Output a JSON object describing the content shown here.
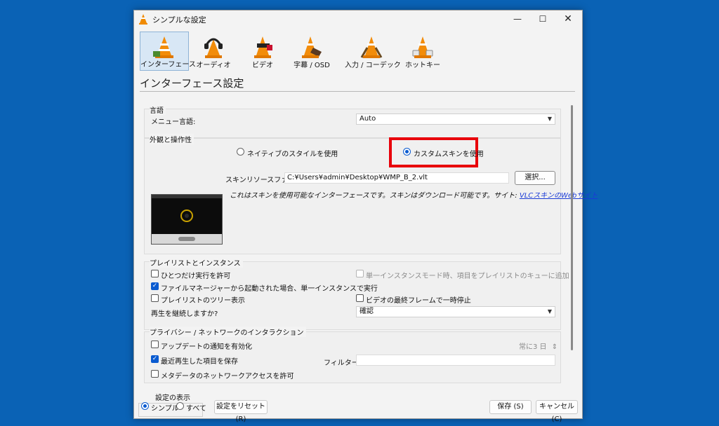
{
  "window": {
    "title": "シンプルな設定",
    "controls": {
      "minimize": "—",
      "maximize": "☐",
      "close": "✕"
    }
  },
  "toolbar": {
    "items": [
      {
        "label": "インターフェース",
        "icon": "interface-cone-icon",
        "active": true
      },
      {
        "label": "オーディオ",
        "icon": "audio-cone-icon",
        "active": false
      },
      {
        "label": "ビデオ",
        "icon": "video-cone-icon",
        "active": false
      },
      {
        "label": "字幕 / OSD",
        "icon": "subtitle-cone-icon",
        "active": false
      },
      {
        "label": "入力 / コーデック",
        "icon": "input-cone-icon",
        "active": false
      },
      {
        "label": "ホットキー",
        "icon": "hotkey-cone-icon",
        "active": false
      }
    ]
  },
  "page": {
    "title": "インターフェース設定"
  },
  "language": {
    "group_label": "言語",
    "menu_language_label": "メニュー言語:",
    "menu_language_value": "Auto"
  },
  "appearance": {
    "group_label": "外観と操作性",
    "native_style_label": "ネイティブのスタイルを使用",
    "custom_skin_label": "カスタムスキンを使用",
    "selected": "custom_skin",
    "skin_file_label": "スキンリソースファイル:",
    "skin_file_value": "C:¥Users¥admin¥Desktop¥WMP_B_2.vlt",
    "choose_button": "選択...",
    "description": "これはスキンを使用可能なインターフェースです。スキンはダウンロード可能です。サイト:",
    "link_text": "VLCスキンのWebサイト"
  },
  "playlist": {
    "group_label": "プレイリストとインスタンス",
    "allow_single": {
      "label": "ひとつだけ実行を許可",
      "checked": false
    },
    "enqueue_single": {
      "label": "単一インスタンスモード時、項目をプレイリストのキューに追加",
      "checked": false,
      "disabled": true
    },
    "file_manager_single": {
      "label": "ファイルマネージャーから起動された場合、単一インスタンスで実行",
      "checked": true
    },
    "tree_view": {
      "label": "プレイリストのツリー表示",
      "checked": false
    },
    "pause_last_frame": {
      "label": "ビデオの最終フレームで一時停止",
      "checked": false
    },
    "resume_label": "再生を継続しますか?",
    "resume_value": "確認"
  },
  "privacy": {
    "group_label": "プライバシー / ネットワークのインタラクション",
    "update_notify": {
      "label": "アップデートの通知を有効化",
      "checked": false
    },
    "update_interval": "常に3 日",
    "save_recent": {
      "label": "最近再生した項目を保存",
      "checked": true
    },
    "filter_label": "フィルター:",
    "filter_value": "",
    "metadata_access": {
      "label": "メタデータのネットワークアクセスを許可",
      "checked": false
    }
  },
  "footer": {
    "show_settings_label": "設定の表示",
    "simple_label": "シンプル",
    "all_label": "すべて",
    "selected": "simple",
    "reset_button": "設定をリセット (R)",
    "save_button": "保存 (S)",
    "cancel_button": "キャンセル (C)"
  },
  "colors": {
    "desktop": "#0a62b5",
    "highlight_box": "#e8000b",
    "accent": "#0a5bd0",
    "link": "#1a3bd6"
  }
}
